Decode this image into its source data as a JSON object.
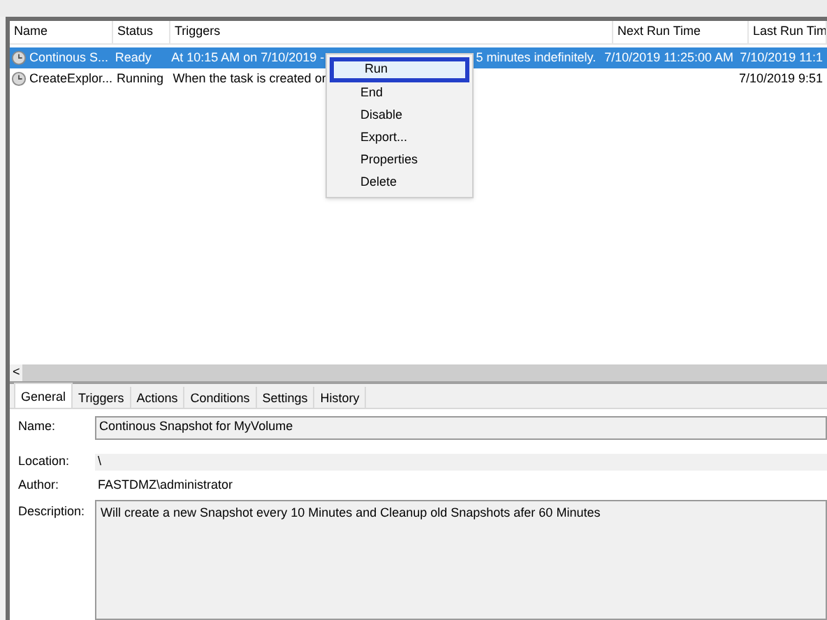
{
  "table": {
    "columns": [
      "Name",
      "Status",
      "Triggers",
      "Next Run Time",
      "Last Run Tim"
    ],
    "rows": [
      {
        "name": "Continous S...",
        "status": "Ready",
        "trigger_before_menu": "At 10:15 AM on 7/10/2019 -",
        "trigger_after_menu": "5 minutes indefinitely.",
        "next_run": "7/10/2019 11:25:00 AM",
        "last_run": "7/10/2019 11:1",
        "selected": true
      },
      {
        "name": "CreateExplor...",
        "status": "Running",
        "trigger_before_menu": "When the task is created or",
        "trigger_after_menu": "",
        "next_run": "",
        "last_run": "7/10/2019 9:51",
        "selected": false
      }
    ]
  },
  "context_menu": {
    "items": [
      {
        "label": "Run",
        "selected": true
      },
      {
        "label": "End",
        "selected": false
      },
      {
        "label": "Disable",
        "selected": false
      },
      {
        "label": "Export...",
        "selected": false
      },
      {
        "label": "Properties",
        "selected": false
      },
      {
        "label": "Delete",
        "selected": false
      }
    ]
  },
  "scrollbar": {
    "left_arrow": "<"
  },
  "tabs": [
    {
      "label": "General",
      "selected": true
    },
    {
      "label": "Triggers",
      "selected": false
    },
    {
      "label": "Actions",
      "selected": false
    },
    {
      "label": "Conditions",
      "selected": false
    },
    {
      "label": "Settings",
      "selected": false
    },
    {
      "label": "History",
      "selected": false
    }
  ],
  "general": {
    "name_label": "Name:",
    "name_value": "Continous Snapshot for MyVolume",
    "location_label": "Location:",
    "location_value": "\\",
    "author_label": "Author:",
    "author_value": "FASTDMZ\\administrator",
    "description_label": "Description:",
    "description_value": "Will create a new Snapshot every 10 Minutes and Cleanup old Snapshots afer 60 Minutes"
  }
}
